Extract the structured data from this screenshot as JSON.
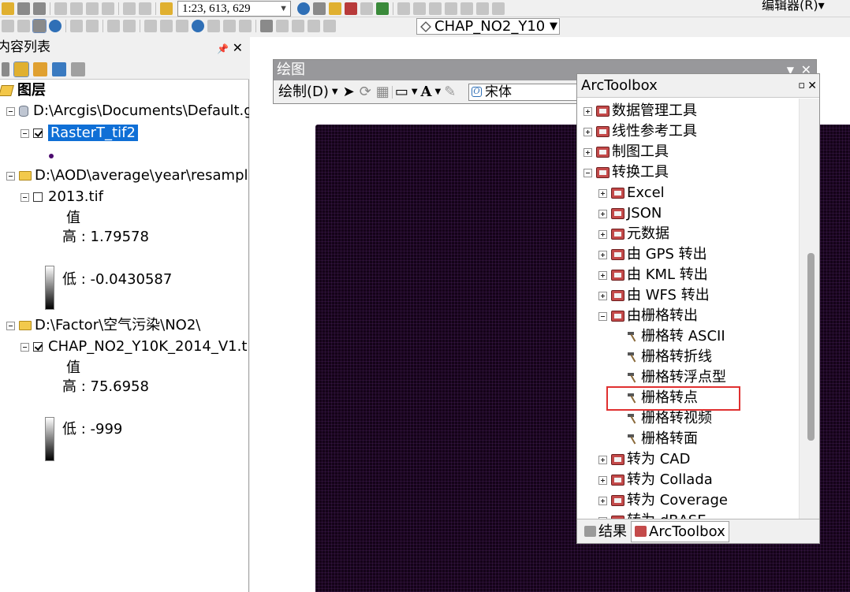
{
  "toolbar": {
    "scale": "1:23, 613, 629",
    "editor_menu": "编辑器(R)▾",
    "layer_combo": "CHAP_NO2_Y10"
  },
  "toc": {
    "title": "内容列表",
    "root": "图层",
    "layers": [
      {
        "source": "D:\\Arcgis\\Documents\\Default.g",
        "name": "RasterT_tif2",
        "checked": true,
        "selected": true
      },
      {
        "source": "D:\\AOD\\average\\year\\resampl",
        "name": "2013.tif",
        "checked": false,
        "legend_title": "值",
        "high": "高 : 1.79578",
        "low": "低 : -0.0430587"
      },
      {
        "source": "D:\\Factor\\空气污染\\NO2\\",
        "name": "CHAP_NO2_Y10K_2014_V1.t",
        "checked": true,
        "legend_title": "值",
        "high": "高 : 75.6958",
        "low": "低 : -999"
      }
    ]
  },
  "drawing": {
    "title": "绘图",
    "menu": "绘制(D)",
    "font": "宋体"
  },
  "arctoolbox": {
    "title": "ArcToolbox",
    "items": [
      {
        "label": "数据管理工具",
        "kind": "toolbox",
        "expanded": false,
        "level": 0
      },
      {
        "label": "线性参考工具",
        "kind": "toolbox",
        "expanded": false,
        "level": 0
      },
      {
        "label": "制图工具",
        "kind": "toolbox",
        "expanded": false,
        "level": 0
      },
      {
        "label": "转换工具",
        "kind": "toolbox",
        "expanded": true,
        "level": 0
      },
      {
        "label": "Excel",
        "kind": "toolset",
        "expanded": false,
        "level": 1
      },
      {
        "label": "JSON",
        "kind": "toolset",
        "expanded": false,
        "level": 1
      },
      {
        "label": "元数据",
        "kind": "toolset",
        "expanded": false,
        "level": 1
      },
      {
        "label": "由 GPS 转出",
        "kind": "toolset",
        "expanded": false,
        "level": 1
      },
      {
        "label": "由 KML 转出",
        "kind": "toolset",
        "expanded": false,
        "level": 1
      },
      {
        "label": "由 WFS 转出",
        "kind": "toolset",
        "expanded": false,
        "level": 1
      },
      {
        "label": "由栅格转出",
        "kind": "toolset",
        "expanded": true,
        "level": 1
      },
      {
        "label": "栅格转 ASCII",
        "kind": "tool",
        "level": 2
      },
      {
        "label": "栅格转折线",
        "kind": "tool",
        "level": 2
      },
      {
        "label": "栅格转浮点型",
        "kind": "tool",
        "level": 2
      },
      {
        "label": "栅格转点",
        "kind": "tool",
        "level": 2,
        "highlighted": true
      },
      {
        "label": "栅格转视频",
        "kind": "tool",
        "level": 2
      },
      {
        "label": "栅格转面",
        "kind": "tool",
        "level": 2
      },
      {
        "label": "转为 CAD",
        "kind": "toolset",
        "expanded": false,
        "level": 1
      },
      {
        "label": "转为 Collada",
        "kind": "toolset",
        "expanded": false,
        "level": 1
      },
      {
        "label": "转为 Coverage",
        "kind": "toolset",
        "expanded": false,
        "level": 1
      },
      {
        "label": "转为 dBASE",
        "kind": "toolset",
        "expanded": false,
        "level": 1
      }
    ],
    "tabs": [
      {
        "label": "结果",
        "active": false
      },
      {
        "label": "ArcToolbox",
        "active": true
      }
    ]
  },
  "colors": {
    "selection": "#0f6fd6",
    "highlight_box": "#e03030",
    "raster": "#140318"
  }
}
